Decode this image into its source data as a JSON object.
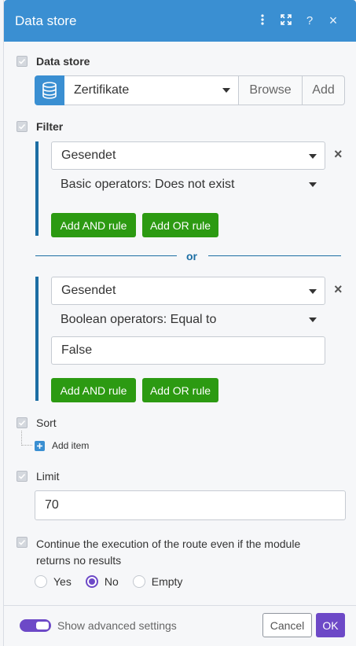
{
  "header": {
    "title": "Data store",
    "icons": [
      "more-vertical-icon",
      "expand-icon",
      "help-icon",
      "close-icon"
    ],
    "help_glyph": "?",
    "close_glyph": "×"
  },
  "data_store": {
    "label": "Data store",
    "selected": "Zertifikate",
    "browse_label": "Browse",
    "add_label": "Add"
  },
  "filter": {
    "label": "Filter",
    "or_label": "or",
    "groups": [
      {
        "field": "Gesendet",
        "operator": "Basic operators: Does not exist",
        "value": null,
        "add_and_label": "Add AND rule",
        "add_or_label": "Add OR rule",
        "remove_glyph": "×"
      },
      {
        "field": "Gesendet",
        "operator": "Boolean operators: Equal to",
        "value": "False",
        "add_and_label": "Add AND rule",
        "add_or_label": "Add OR rule",
        "remove_glyph": "×"
      }
    ]
  },
  "sort": {
    "label": "Sort",
    "add_item_label": "Add item"
  },
  "limit": {
    "label": "Limit",
    "value": "70"
  },
  "continue": {
    "label_line1": "Continue the execution of the route even if the module",
    "label_line2": "returns no results",
    "options": [
      {
        "label": "Yes",
        "selected": false
      },
      {
        "label": "No",
        "selected": true
      },
      {
        "label": "Empty",
        "selected": false
      }
    ]
  },
  "footer": {
    "advanced_label": "Show advanced settings",
    "advanced_on": true,
    "cancel_label": "Cancel",
    "ok_label": "OK"
  },
  "colors": {
    "header_bg": "#3a8fd2",
    "filter_accent": "#1c6ea4",
    "green_button": "#2c9a12",
    "purple_accent": "#6d49c7"
  }
}
